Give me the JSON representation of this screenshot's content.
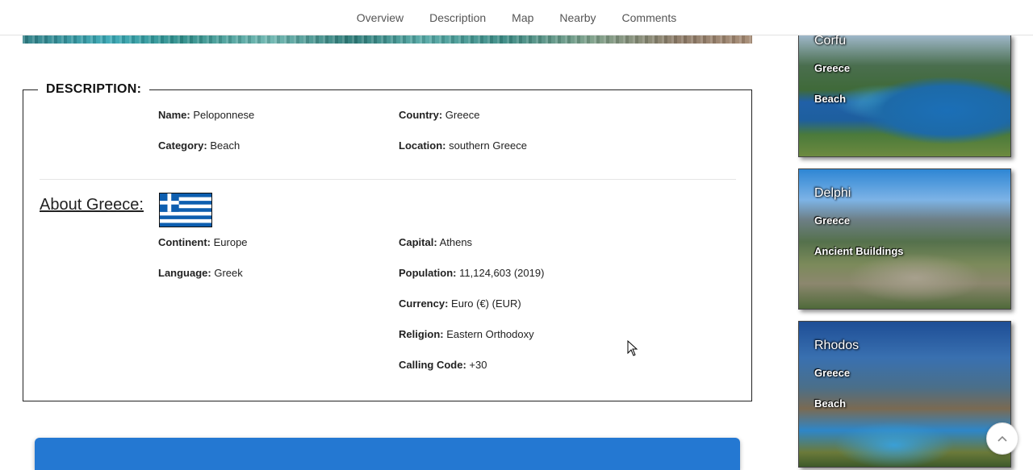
{
  "nav": {
    "items": [
      "Overview",
      "Description",
      "Map",
      "Nearby",
      "Comments"
    ]
  },
  "description": {
    "legend": "DESCRIPTION:",
    "name_label": "Name:",
    "name_value": "Peloponnese",
    "country_label": "Country:",
    "country_value": "Greece",
    "category_label": "Category:",
    "category_value": "Beach",
    "location_label": "Location:",
    "location_value": "southern Greece"
  },
  "about": {
    "heading": "About Greece:",
    "continent_label": "Continent:",
    "continent_value": "Europe",
    "language_label": "Language:",
    "language_value": "Greek",
    "capital_label": "Capital:",
    "capital_value": "Athens",
    "population_label": "Population:",
    "population_value": "11,124,603 (2019)",
    "currency_label": "Currency:",
    "currency_value": "Euro (€) (EUR)",
    "religion_label": "Religion:",
    "religion_value": "Eastern Orthodoxy",
    "calling_label": "Calling Code:",
    "calling_value": "+30",
    "flag_icon": "greece-flag-icon"
  },
  "sidebar": {
    "cards": [
      {
        "title": "Corfu",
        "country": "Greece",
        "category": "Beach"
      },
      {
        "title": "Delphi",
        "country": "Greece",
        "category": "Ancient Buildings"
      },
      {
        "title": "Rhodos",
        "country": "Greece",
        "category": "Beach"
      }
    ]
  },
  "colors": {
    "accent_blue": "#2478d2",
    "flag_blue": "#0d5eaf"
  },
  "icons": {
    "scroll_top": "chevron-up-icon",
    "cursor": "mouse-pointer-icon"
  }
}
